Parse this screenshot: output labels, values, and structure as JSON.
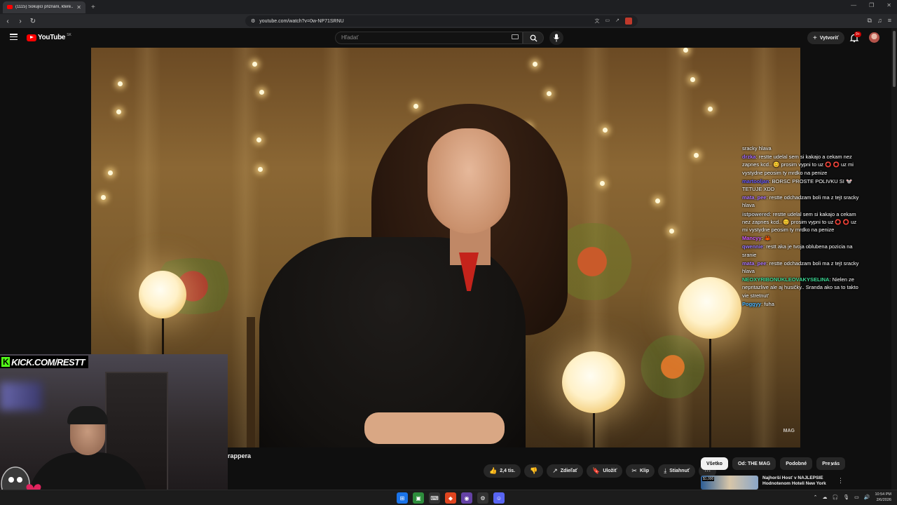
{
  "browser": {
    "tab_title": "(1115) Šokující přiznání, které...",
    "url": "youtube.com/watch?v=0w-NP71SRNU",
    "win_controls": [
      "—",
      "❐",
      "✕"
    ]
  },
  "youtube": {
    "logo_text": "YouTube",
    "country_code": "SK",
    "search_placeholder": "Hľadať",
    "create_label": "Vytvoriť",
    "notif_badge": "9+"
  },
  "video": {
    "watermark": "MAG",
    "title_fragment": "rappera"
  },
  "chat": [
    {
      "user": "",
      "text": "sracky hlava",
      "color": "#ffffff"
    },
    {
      "user": "drzka",
      "text": "restte udelal sem si kakajo a cekam nez zapnes kcd.. 😊 prosim vypni to uz ⭕ ⭕ uz mi vystydne peosim ty mrdko na penize",
      "color": "#a970ff"
    },
    {
      "user": "martooljan",
      "text": "BORSC PROSTE POLIVKU SI 🐭 TETUJE XDD",
      "color": "#6a5cff"
    },
    {
      "user": "mata_pee",
      "text": "restte odchadzam boli ma z tejt sracky hlava",
      "color": "#b07aff"
    },
    {
      "user": "istpowered",
      "text": "restte udelal sem si kakajo a cekam nez zapnes kcd.. 😊 prosim vypni to uz ⭕ ⭕ uz mi vystydne peosim ty mrdko na penize",
      "color": "#cfcfcf"
    },
    {
      "user": "Mancyy",
      "text": "🦀",
      "color": "#d25cff"
    },
    {
      "user": "qwennie",
      "text": "restt aka je tvoja oblubena pozicia na sranie",
      "color": "#9b7bff"
    },
    {
      "user": "mata_pee",
      "text": "restte odchadzam boli ma z tejt sracky hlava",
      "color": "#b07aff"
    },
    {
      "user": "NEOXYRIBONUKLEOVAKYSELINA",
      "text": "Nielen ze nepritazlive ale aj husičky.. Sranda ako sa to takto vie stretnut'",
      "color": "#3ddc97"
    },
    {
      "user": "Poggyy",
      "text": "fuha",
      "color": "#4fb8ff"
    }
  ],
  "stream": {
    "kick_label": "KICK.COM/RESTT"
  },
  "actions": [
    {
      "icon": "like-icon",
      "glyph": "👍",
      "label": "2,4 tis."
    },
    {
      "icon": "dislike-icon",
      "glyph": "👎",
      "label": ""
    },
    {
      "icon": "share-icon",
      "glyph": "↗",
      "label": "Zdieľať"
    },
    {
      "icon": "save-icon",
      "glyph": "🔖",
      "label": "Uložiť"
    },
    {
      "icon": "clip-icon",
      "glyph": "✂",
      "label": "Klip"
    },
    {
      "icon": "download-icon",
      "glyph": "⤓",
      "label": "Stiahnuť"
    },
    {
      "icon": "more-icon",
      "glyph": "⋯",
      "label": ""
    }
  ],
  "chips": [
    "Všetko",
    "Od: THE MAG",
    "Podobné",
    "Pre vás"
  ],
  "recommendation": {
    "thumb_badge": "$1,000",
    "title": "Najhorší Hosť v NAJLEPŠIE Hodnotenom Hoteli New York"
  },
  "taskbar": {
    "time": "10:54 PM",
    "date": "2/6/2026"
  }
}
